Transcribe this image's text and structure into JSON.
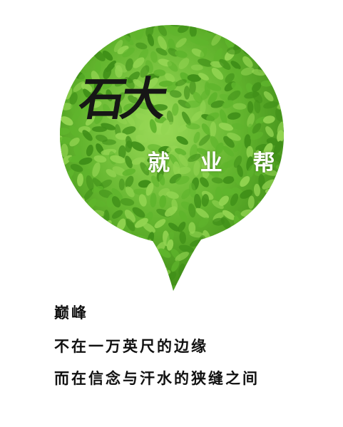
{
  "logo": {
    "mark": "石大",
    "brand_name": "就 业 帮"
  },
  "poem": {
    "title": "巅峰",
    "line1": "不在一万英尺的边缘",
    "line2": "而在信念与汗水的狭缝之间"
  },
  "colors": {
    "leaf_dark": "#3f8f18",
    "leaf_mid": "#5fb52c",
    "leaf_light": "#93d552",
    "text": "#111111",
    "background": "#ffffff"
  }
}
